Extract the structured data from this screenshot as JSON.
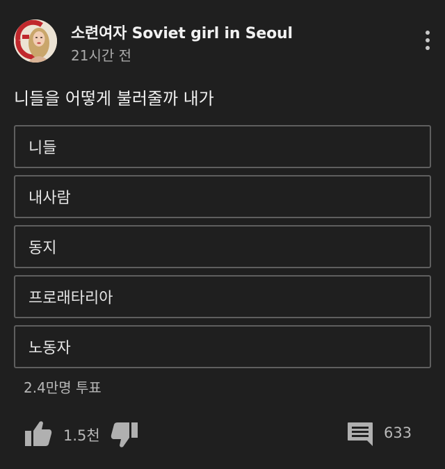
{
  "post": {
    "channel_name": "소련여자 Soviet girl in Seoul",
    "time_ago": "21시간 전",
    "question": "니들을 어떻게 불러줄까 내가"
  },
  "poll": {
    "options": [
      {
        "label": "니들"
      },
      {
        "label": "내사람"
      },
      {
        "label": "동지"
      },
      {
        "label": "프로래타리아"
      },
      {
        "label": "노동자"
      }
    ],
    "vote_count": "2.4만명 투표"
  },
  "actions": {
    "like_count": "1.5천",
    "comment_count": "633"
  },
  "colors": {
    "background": "#1f1f1f",
    "option_border": "#5f5f5f",
    "icon_gray": "#b0b0b0",
    "avatar_red": "#c0282d"
  },
  "icons": {
    "menu": "more-vert-icon",
    "like": "thumbs-up-icon",
    "dislike": "thumbs-down-icon",
    "comment": "comment-icon"
  }
}
